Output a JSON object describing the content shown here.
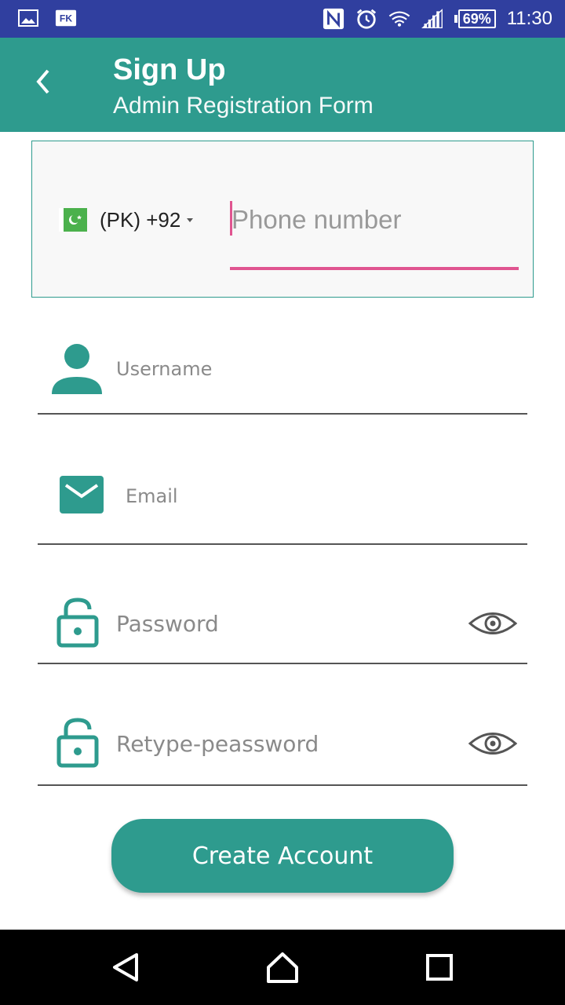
{
  "status_bar": {
    "battery": "69%",
    "time": "11:30",
    "icons": [
      "gallery-icon",
      "fk-app-icon",
      "nfc-icon",
      "alarm-icon",
      "wifi-icon",
      "signal-icon",
      "battery-icon"
    ]
  },
  "app_bar": {
    "title": "Sign Up",
    "subtitle": "Admin Registration Form"
  },
  "phone": {
    "country": "(PK) +92",
    "placeholder": "Phone number",
    "accent": "#e05590"
  },
  "form": {
    "username_placeholder": "Username",
    "email_placeholder": "Email",
    "password_placeholder": "Password",
    "retype_placeholder": "Retype-peassword"
  },
  "button": {
    "create_label": "Create Account"
  },
  "colors": {
    "primary": "#2e9b8e",
    "status_bar": "#303f9f"
  }
}
